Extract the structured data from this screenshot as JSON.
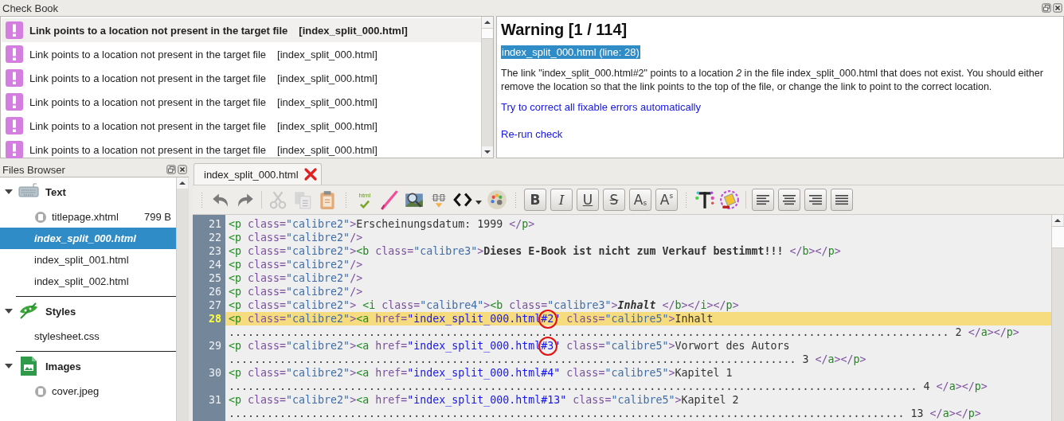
{
  "check_book": {
    "title": "Check Book",
    "items": [
      {
        "message": "Link points to a location not present in the target file",
        "file": "[index_split_000.html]",
        "selected": true
      },
      {
        "message": "Link points to a location not present in the target file",
        "file": "[index_split_000.html]",
        "selected": false
      },
      {
        "message": "Link points to a location not present in the target file",
        "file": "[index_split_000.html]",
        "selected": false
      },
      {
        "message": "Link points to a location not present in the target file",
        "file": "[index_split_000.html]",
        "selected": false
      },
      {
        "message": "Link points to a location not present in the target file",
        "file": "[index_split_000.html]",
        "selected": false
      },
      {
        "message": "Link points to a location not present in the target file",
        "file": "[index_split_000.html]",
        "selected": false
      }
    ]
  },
  "detail": {
    "heading": "Warning [1 / 114]",
    "location": "index_split_000.html (line: 28)",
    "description": "The link \"index_split_000.html#2\" points to a location *2* in the file index_split_000.html that does not exist. You should either remove the location so that the link points to the top of the file, or change the link to point to the correct location.",
    "links": [
      "Try to correct all fixable errors automatically",
      "Re-run check"
    ]
  },
  "files_browser": {
    "title": "Files Browser",
    "groups": [
      {
        "name": "Text",
        "kind": "text",
        "expanded": true,
        "children": [
          {
            "name": "titlepage.xhtml",
            "size": "799 B",
            "marked": true,
            "selected": false
          },
          {
            "name": "index_split_000.html",
            "marked": false,
            "selected": true
          },
          {
            "name": "index_split_001.html",
            "marked": false,
            "selected": false
          },
          {
            "name": "index_split_002.html",
            "marked": false,
            "selected": false
          }
        ]
      },
      {
        "name": "Styles",
        "kind": "styles",
        "expanded": true,
        "children": [
          {
            "name": "stylesheet.css",
            "marked": false,
            "selected": false
          }
        ]
      },
      {
        "name": "Images",
        "kind": "images",
        "expanded": true,
        "children": [
          {
            "name": "cover.jpeg",
            "marked": true,
            "selected": false
          }
        ]
      }
    ]
  },
  "editor": {
    "tabs": [
      {
        "label": "index_split_000.html",
        "selected": true
      }
    ],
    "toolbar": {
      "validate_label": "html",
      "format_buttons": [
        {
          "kind": "bold",
          "label": "B"
        },
        {
          "kind": "italic",
          "label": "I"
        },
        {
          "kind": "underline",
          "label": "U"
        },
        {
          "kind": "strike",
          "label": "S"
        },
        {
          "kind": "subscript",
          "label": "A",
          "small": "s"
        },
        {
          "kind": "superscript",
          "label": "A",
          "small": "s"
        }
      ]
    },
    "lines": [
      {
        "number": "21",
        "current": false,
        "segments": [
          {
            "kind": "tag",
            "text": "<p"
          },
          {
            "kind": "attr",
            "text": " class="
          },
          {
            "kind": "value",
            "text": "\"calibre2\""
          },
          {
            "kind": "attr",
            "text": ">"
          },
          {
            "kind": "text",
            "text": "Erscheinungsdatum: 1999 "
          },
          {
            "kind": "attr",
            "text": "</"
          },
          {
            "kind": "tag",
            "text": "p"
          },
          {
            "kind": "attr",
            "text": ">"
          }
        ]
      },
      {
        "number": "22",
        "current": false,
        "segments": [
          {
            "kind": "tag",
            "text": "<p"
          },
          {
            "kind": "attr",
            "text": " class="
          },
          {
            "kind": "value",
            "text": "\"calibre2\""
          },
          {
            "kind": "attr",
            "text": "/>"
          }
        ]
      },
      {
        "number": "23",
        "current": false,
        "segments": [
          {
            "kind": "tag",
            "text": "<p"
          },
          {
            "kind": "attr",
            "text": " class="
          },
          {
            "kind": "value",
            "text": "\"calibre2\""
          },
          {
            "kind": "attr",
            "text": ">"
          },
          {
            "kind": "tag",
            "text": "<b"
          },
          {
            "kind": "attr",
            "text": " class="
          },
          {
            "kind": "value",
            "text": "\"calibre3\""
          },
          {
            "kind": "attr",
            "text": ">"
          },
          {
            "kind": "bold",
            "text": "Dieses E-Book ist nicht zum Verkauf bestimmt!!!"
          },
          {
            "kind": "attr",
            "text": " </"
          },
          {
            "kind": "tag",
            "text": "b"
          },
          {
            "kind": "attr",
            "text": "></"
          },
          {
            "kind": "tag",
            "text": "p"
          },
          {
            "kind": "attr",
            "text": ">"
          }
        ]
      },
      {
        "number": "24",
        "current": false,
        "segments": [
          {
            "kind": "tag",
            "text": "<p"
          },
          {
            "kind": "attr",
            "text": " class="
          },
          {
            "kind": "value",
            "text": "\"calibre2\""
          },
          {
            "kind": "attr",
            "text": "/>"
          }
        ]
      },
      {
        "number": "25",
        "current": false,
        "segments": [
          {
            "kind": "tag",
            "text": "<p"
          },
          {
            "kind": "attr",
            "text": " class="
          },
          {
            "kind": "value",
            "text": "\"calibre2\""
          },
          {
            "kind": "attr",
            "text": "/>"
          }
        ]
      },
      {
        "number": "26",
        "current": false,
        "segments": [
          {
            "kind": "tag",
            "text": "<p"
          },
          {
            "kind": "attr",
            "text": " class="
          },
          {
            "kind": "value",
            "text": "\"calibre2\""
          },
          {
            "kind": "attr",
            "text": "/>"
          }
        ]
      },
      {
        "number": "27",
        "current": false,
        "segments": [
          {
            "kind": "tag",
            "text": "<p"
          },
          {
            "kind": "attr",
            "text": " class="
          },
          {
            "kind": "value",
            "text": "\"calibre2\""
          },
          {
            "kind": "attr",
            "text": ">"
          },
          {
            "kind": "tag",
            "text": " <i"
          },
          {
            "kind": "attr",
            "text": " class="
          },
          {
            "kind": "value",
            "text": "\"calibre4\""
          },
          {
            "kind": "attr",
            "text": ">"
          },
          {
            "kind": "tag",
            "text": "<b"
          },
          {
            "kind": "attr",
            "text": " class="
          },
          {
            "kind": "value",
            "text": "\"calibre3\""
          },
          {
            "kind": "attr",
            "text": ">"
          },
          {
            "kind": "bolditalic",
            "text": "Inhalt"
          },
          {
            "kind": "attr",
            "text": " </"
          },
          {
            "kind": "tag",
            "text": "b"
          },
          {
            "kind": "attr",
            "text": "></"
          },
          {
            "kind": "tag",
            "text": "i"
          },
          {
            "kind": "attr",
            "text": "></"
          },
          {
            "kind": "tag",
            "text": "p"
          },
          {
            "kind": "attr",
            "text": ">"
          }
        ]
      },
      {
        "number": "28",
        "current": true,
        "segments": [
          {
            "kind": "tag",
            "text": "<p"
          },
          {
            "kind": "attr",
            "text": " class="
          },
          {
            "kind": "value",
            "text": "\"calibre2\""
          },
          {
            "kind": "attr",
            "text": ">"
          },
          {
            "kind": "tag",
            "text": "<a"
          },
          {
            "kind": "attr",
            "text": " href="
          },
          {
            "kind": "href",
            "text": "\"index_split_000.html"
          },
          {
            "kind": "circled",
            "text": "#2"
          },
          {
            "kind": "href",
            "text": "\""
          },
          {
            "kind": "attr",
            "text": " class="
          },
          {
            "kind": "value",
            "text": "\"calibre5\""
          },
          {
            "kind": "attr",
            "text": ">"
          },
          {
            "kind": "text",
            "text": "Inhalt"
          }
        ],
        "continuation": [
          {
            "kind": "text",
            "text": "................................................................................................................. 2 "
          },
          {
            "kind": "attr",
            "text": "</"
          },
          {
            "kind": "tag",
            "text": "a"
          },
          {
            "kind": "attr",
            "text": "></"
          },
          {
            "kind": "tag",
            "text": "p"
          },
          {
            "kind": "attr",
            "text": ">"
          }
        ]
      },
      {
        "number": "29",
        "current": false,
        "segments": [
          {
            "kind": "tag",
            "text": "<p"
          },
          {
            "kind": "attr",
            "text": " class="
          },
          {
            "kind": "value",
            "text": "\"calibre2\""
          },
          {
            "kind": "attr",
            "text": ">"
          },
          {
            "kind": "tag",
            "text": "<a"
          },
          {
            "kind": "attr",
            "text": " href="
          },
          {
            "kind": "href",
            "text": "\"index_split_000.html"
          },
          {
            "kind": "circled",
            "text": "#3"
          },
          {
            "kind": "href",
            "text": "\""
          },
          {
            "kind": "attr",
            "text": " class="
          },
          {
            "kind": "value",
            "text": "\"calibre5\""
          },
          {
            "kind": "attr",
            "text": ">"
          },
          {
            "kind": "text",
            "text": "Vorwort des Autors"
          }
        ],
        "continuation": [
          {
            "kind": "text",
            "text": "......................................................................................... 3 "
          },
          {
            "kind": "attr",
            "text": "</"
          },
          {
            "kind": "tag",
            "text": "a"
          },
          {
            "kind": "attr",
            "text": "></"
          },
          {
            "kind": "tag",
            "text": "p"
          },
          {
            "kind": "attr",
            "text": ">"
          }
        ]
      },
      {
        "number": "30",
        "current": false,
        "segments": [
          {
            "kind": "tag",
            "text": "<p"
          },
          {
            "kind": "attr",
            "text": " class="
          },
          {
            "kind": "value",
            "text": "\"calibre2\""
          },
          {
            "kind": "attr",
            "text": ">"
          },
          {
            "kind": "tag",
            "text": "<a"
          },
          {
            "kind": "attr",
            "text": " href="
          },
          {
            "kind": "href",
            "text": "\"index_split_000.html#4\""
          },
          {
            "kind": "attr",
            "text": " class="
          },
          {
            "kind": "value",
            "text": "\"calibre5\""
          },
          {
            "kind": "attr",
            "text": ">"
          },
          {
            "kind": "text",
            "text": "Kapitel 1"
          }
        ],
        "continuation": [
          {
            "kind": "text",
            "text": "............................................................................................................ 4 "
          },
          {
            "kind": "attr",
            "text": "</"
          },
          {
            "kind": "tag",
            "text": "a"
          },
          {
            "kind": "attr",
            "text": "></"
          },
          {
            "kind": "tag",
            "text": "p"
          },
          {
            "kind": "attr",
            "text": ">"
          }
        ]
      },
      {
        "number": "31",
        "current": false,
        "segments": [
          {
            "kind": "tag",
            "text": "<p"
          },
          {
            "kind": "attr",
            "text": " class="
          },
          {
            "kind": "value",
            "text": "\"calibre2\""
          },
          {
            "kind": "attr",
            "text": ">"
          },
          {
            "kind": "tag",
            "text": "<a"
          },
          {
            "kind": "attr",
            "text": " href="
          },
          {
            "kind": "href",
            "text": "\"index_split_000.html#13\""
          },
          {
            "kind": "attr",
            "text": " class="
          },
          {
            "kind": "value",
            "text": "\"calibre5\""
          },
          {
            "kind": "attr",
            "text": ">"
          },
          {
            "kind": "text",
            "text": "Kapitel 2"
          }
        ],
        "continuation": [
          {
            "kind": "text",
            "text": ".......................................................................................................... 13 "
          },
          {
            "kind": "attr",
            "text": "</"
          },
          {
            "kind": "tag",
            "text": "a"
          },
          {
            "kind": "attr",
            "text": "></"
          },
          {
            "kind": "tag",
            "text": "p"
          },
          {
            "kind": "attr",
            "text": ">"
          }
        ]
      }
    ]
  }
}
